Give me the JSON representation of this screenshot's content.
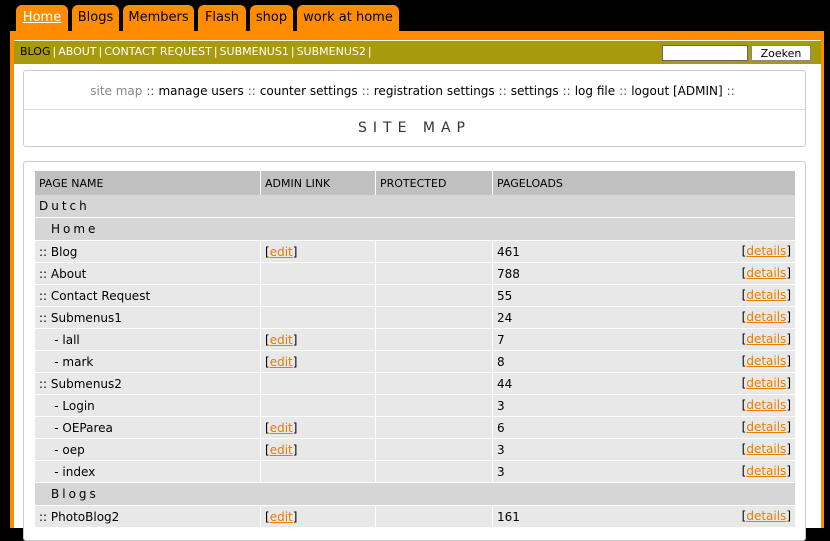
{
  "tabs": [
    "Home",
    "Blogs",
    "Members",
    "Flash",
    "shop",
    "work at home"
  ],
  "subnav": {
    "links": [
      "BLOG",
      "ABOUT",
      "CONTACT REQUEST",
      "SUBMENUS1",
      "SUBMENUS2"
    ],
    "search_button": "Zoeken"
  },
  "adminnav": [
    "site map",
    "manage users",
    "counter settings",
    "registration settings",
    "settings",
    "log file",
    "logout [ADMIN]"
  ],
  "adminnav_sep": "::",
  "page_title": "SITE MAP",
  "table": {
    "headers": [
      "PAGE NAME",
      "ADMIN LINK",
      "PROTECTED",
      "PAGELOADS"
    ],
    "edit_label": "edit",
    "details_label": "details",
    "rows": [
      {
        "kind": "lang",
        "label": "Dutch"
      },
      {
        "kind": "section",
        "label": "Home"
      },
      {
        "kind": "page",
        "name": ":: Blog",
        "edit": true,
        "protected": "",
        "loads": "461"
      },
      {
        "kind": "page",
        "name": ":: About",
        "edit": false,
        "protected": "",
        "loads": "788"
      },
      {
        "kind": "page",
        "name": ":: Contact Request",
        "edit": false,
        "protected": "",
        "loads": "55"
      },
      {
        "kind": "page",
        "name": ":: Submenus1",
        "edit": false,
        "protected": "",
        "loads": "24"
      },
      {
        "kind": "page",
        "name": "    - lall",
        "edit": true,
        "protected": "",
        "loads": "7"
      },
      {
        "kind": "page",
        "name": "    - mark",
        "edit": true,
        "protected": "",
        "loads": "8"
      },
      {
        "kind": "page",
        "name": ":: Submenus2",
        "edit": false,
        "protected": "",
        "loads": "44"
      },
      {
        "kind": "page",
        "name": "    - Login",
        "edit": false,
        "protected": "",
        "loads": "3"
      },
      {
        "kind": "page",
        "name": "    - OEParea",
        "edit": true,
        "protected": "",
        "loads": "6"
      },
      {
        "kind": "page",
        "name": "    - oep",
        "edit": true,
        "protected": "",
        "loads": "3"
      },
      {
        "kind": "page",
        "name": "    - index",
        "edit": false,
        "protected": "",
        "loads": "3"
      },
      {
        "kind": "section",
        "label": "Blogs"
      },
      {
        "kind": "page",
        "name": ":: PhotoBlog2",
        "edit": true,
        "protected": "",
        "loads": "161"
      }
    ]
  },
  "colors": {
    "accent": "#ff8c00",
    "subnav": "#a89a0d",
    "link": "#e67e00"
  }
}
